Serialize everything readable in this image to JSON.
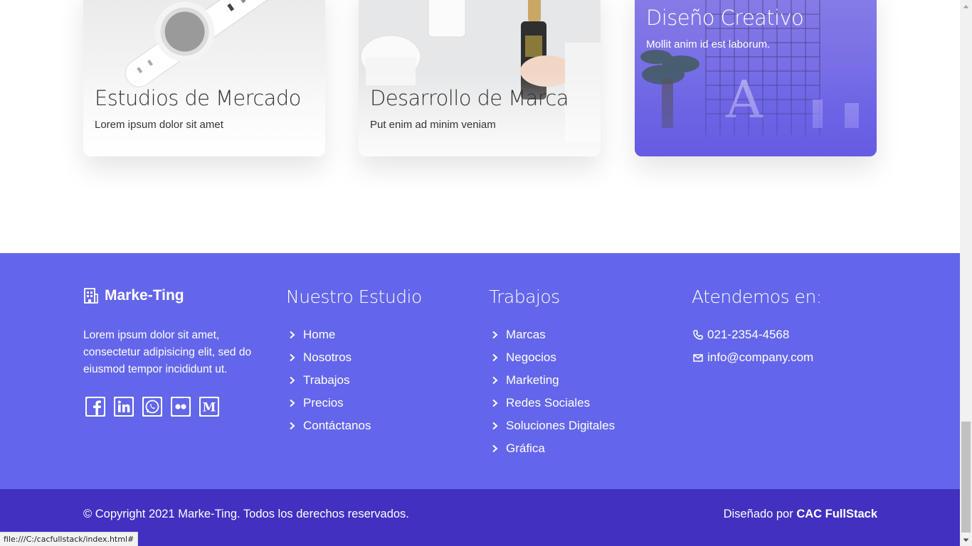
{
  "cards": [
    {
      "title": "Estudios de Mercado",
      "subtitle": "Lorem ipsum dolor sit amet"
    },
    {
      "title": "Desarrollo de Marca",
      "subtitle": "Put enim ad minim veniam"
    },
    {
      "title": "Diseño Creativo",
      "subtitle": "Mollit anim id est laborum."
    }
  ],
  "footer": {
    "brand": "Marke-Ting",
    "about": "Lorem ipsum dolor sit amet, consectetur adipisicing elit, sed do eiusmod tempor incididunt ut.",
    "social": [
      "facebook-icon",
      "linkedin-icon",
      "whatsapp-icon",
      "flickr-icon",
      "medium-icon"
    ],
    "studio": {
      "title": "Nuestro Estudio",
      "links": [
        "Home",
        "Nosotros",
        "Trabajos",
        "Precios",
        "Contáctanos"
      ]
    },
    "works": {
      "title": "Trabajos",
      "links": [
        "Marcas",
        "Negocios",
        "Marketing",
        "Redes Sociales",
        "Soluciones Digitales",
        "Gráfica"
      ]
    },
    "contact": {
      "title": "Atendemos en:",
      "phone": "021-2354-4568",
      "email": "info@company.com"
    }
  },
  "bottom": {
    "copyright": "© Copyright 2021 Marke-Ting. Todos los derechos reservados.",
    "designed_prefix": "Diseñado por ",
    "designed_by": "CAC FullStack"
  },
  "status_bar": {
    "url": "file:///C:/cacfullstack/index.html#"
  },
  "colors": {
    "footer": "#6366ea",
    "bottom_bar": "#4230c0",
    "card3": "#7168e6"
  }
}
